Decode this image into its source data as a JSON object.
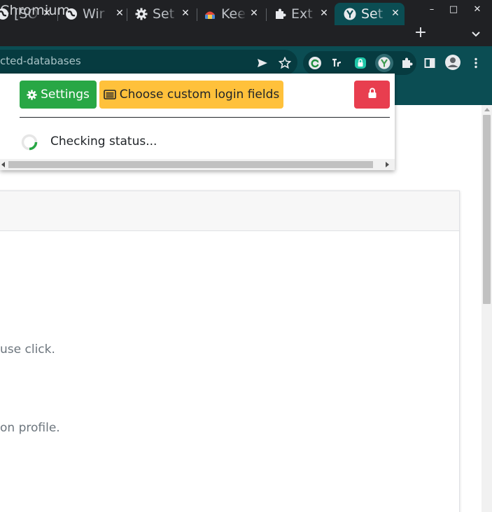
{
  "window": {
    "title": "Chromium",
    "controls": {
      "minimize": "–",
      "maximize": "□",
      "close": "✕"
    }
  },
  "tabs": [
    {
      "label": "[SO",
      "icon": "globe-icon",
      "active": false
    },
    {
      "label": "Wir",
      "icon": "globe-icon",
      "active": false
    },
    {
      "label": "Set",
      "icon": "gear-icon",
      "active": false
    },
    {
      "label": "Kee",
      "icon": "keepass-icon",
      "active": false
    },
    {
      "label": "Ext",
      "icon": "puzzle-icon",
      "active": false
    },
    {
      "label": "Set",
      "icon": "keepassxc-icon",
      "active": true
    }
  ],
  "tab_close": "✕",
  "new_tab": "+",
  "address_bar": {
    "url": "cted-databases"
  },
  "popup": {
    "settings_label": "Settings",
    "custom_fields_label": "Choose custom login fields",
    "status": "Checking status..."
  },
  "page": {
    "line1": "use click.",
    "line2": "on profile."
  },
  "colors": {
    "settings_button": "#28a745",
    "custom_button": "#ffc13b",
    "lock_button": "#e83e4f",
    "toolbar": "#0b4d53",
    "titlebar": "#202124"
  }
}
